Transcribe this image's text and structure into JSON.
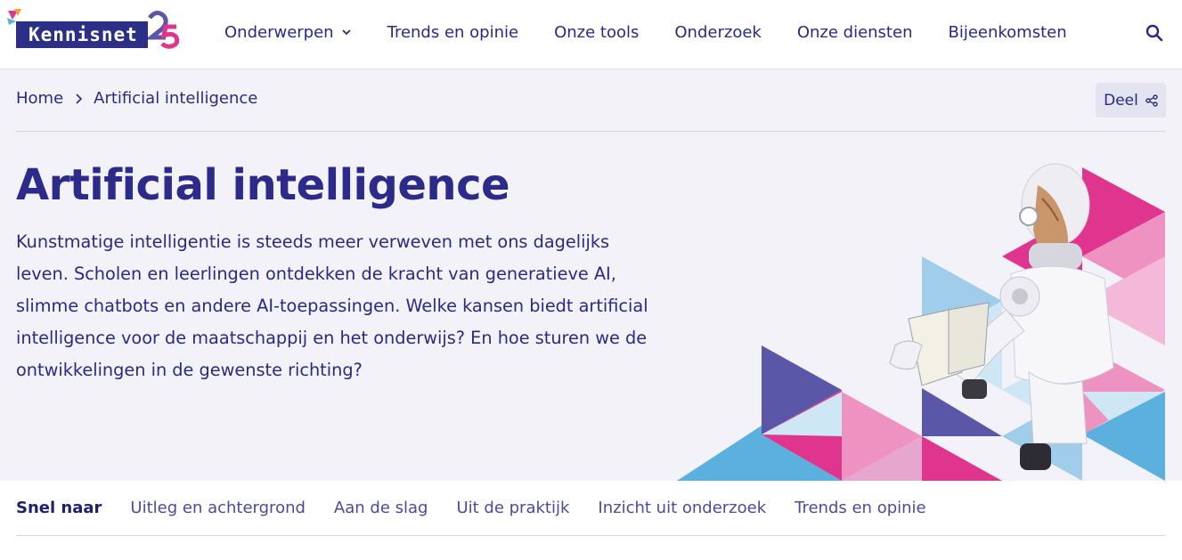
{
  "brand": {
    "logo_text": "Kennisnet",
    "anniversary": "25"
  },
  "nav": {
    "items": [
      {
        "label": "Onderwerpen",
        "has_dropdown": true
      },
      {
        "label": "Trends en opinie"
      },
      {
        "label": "Onze tools"
      },
      {
        "label": "Onderzoek"
      },
      {
        "label": "Onze diensten"
      },
      {
        "label": "Bijeenkomsten"
      }
    ],
    "search_icon": "search-icon"
  },
  "breadcrumb": {
    "home": "Home",
    "current": "Artificial intelligence"
  },
  "share": {
    "label": "Deel",
    "icon": "share-icon"
  },
  "hero": {
    "title": "Artificial intelligence",
    "intro": "Kunstmatige intelligentie is steeds meer verweven met ons dagelijks leven. Scholen en leerlingen ontdekken de kracht van generatieve AI, slimme chatbots en andere AI-toepassingen. Welke kansen biedt artificial intelligence voor de maatschappij en het onderwijs? En hoe sturen we de ontwikkelingen in de gewenste richting?",
    "image": "robot-reading-book-illustration"
  },
  "quicknav": {
    "lead": "Snel naar",
    "links": [
      "Uitleg en achtergrond",
      "Aan de slag",
      "Uit de praktijk",
      "Inzicht uit onderzoek",
      "Trends en opinie"
    ]
  },
  "colors": {
    "primary": "#2c2a8a",
    "hero_bg": "#f3f2f8",
    "magenta": "#e0358f",
    "pink": "#ee92c2",
    "purple": "#5a57a8",
    "light_blue": "#9fcdea",
    "blue": "#5bb0de"
  }
}
